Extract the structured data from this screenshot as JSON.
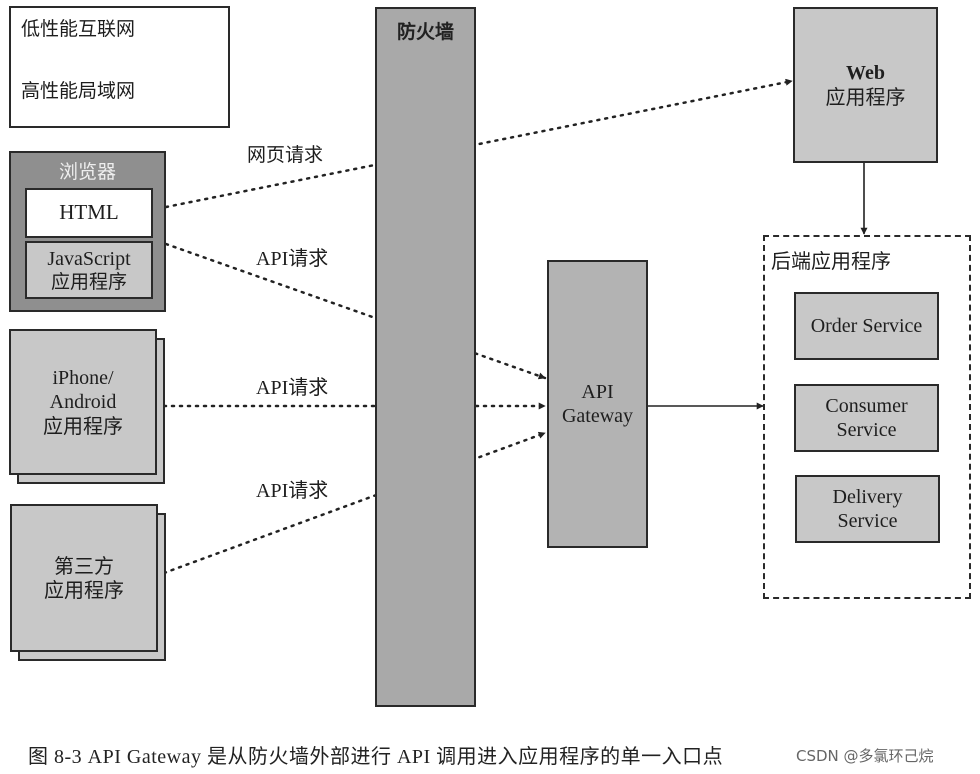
{
  "legend": {
    "low_perf_label": "低性能互联网",
    "high_perf_label": "高性能局域网"
  },
  "firewall": {
    "label": "防火墙"
  },
  "browser": {
    "title": "浏览器",
    "html_label": "HTML",
    "js_line1": "JavaScript",
    "js_line2": "应用程序"
  },
  "mobile_app": {
    "line1": "iPhone/",
    "line2": "Android",
    "line3": "应用程序"
  },
  "third_party_app": {
    "line1": "第三方",
    "line2": "应用程序"
  },
  "web_app": {
    "line1": "Web",
    "line2": "应用程序"
  },
  "api_gateway": {
    "line1": "API",
    "line2": "Gateway"
  },
  "backend": {
    "title": "后端应用程序",
    "services": [
      {
        "line1": "Order Service",
        "line2": ""
      },
      {
        "line1": "Consumer",
        "line2": "Service"
      },
      {
        "line1": "Delivery",
        "line2": "Service"
      }
    ]
  },
  "connections": {
    "web_request_label": "网页请求",
    "api_request_label_1": "API请求",
    "api_request_label_2": "API请求",
    "api_request_label_3": "API请求"
  },
  "caption": {
    "text": "图 8-3   API Gateway 是从防火墙外部进行 API 调用进入应用程序的单一入口点",
    "watermark": "CSDN @多氯环己烷"
  },
  "colors": {
    "box_fill": "#c8c8c8",
    "firewall_fill": "#a9a9a9",
    "gateway_fill": "#b3b3b3",
    "browser_fill": "#8f8f8f",
    "line": "#222222"
  }
}
